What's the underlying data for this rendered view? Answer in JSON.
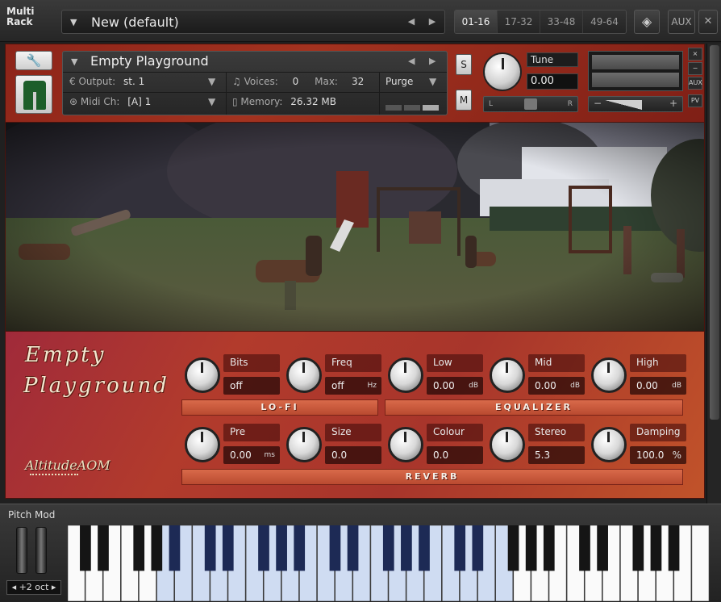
{
  "rack": {
    "title_line1": "Multi",
    "title_line2": "Rack",
    "preset_name": "New (default)",
    "pages": [
      "01-16",
      "17-32",
      "33-48",
      "49-64"
    ],
    "active_page": 0,
    "aux_label": "AUX"
  },
  "instrument": {
    "name": "Empty Playground",
    "output_label": "Output:",
    "output_value": "st. 1",
    "midi_label": "Midi Ch:",
    "midi_value": "[A] 1",
    "voices_label": "Voices:",
    "voices_value": "0",
    "max_label": "Max:",
    "max_value": "32",
    "memory_label": "Memory:",
    "memory_value": "26.32 MB",
    "purge_label": "Purge",
    "solo_label": "S",
    "mute_label": "M",
    "tune_label": "Tune",
    "tune_value": "0.00",
    "pan_left": "L",
    "pan_right": "R",
    "vol_minus": "−",
    "vol_plus": "+",
    "side_close": "×",
    "side_min": "−",
    "side_aux": "AUX",
    "side_pv": "PV"
  },
  "panel": {
    "logo_line1": "Empty",
    "logo_line2": "Playground",
    "brand": "AltitudeAOM",
    "lofi": {
      "section_label": "LO-FI",
      "controls": [
        {
          "label": "Bits",
          "value": "off",
          "unit": ""
        },
        {
          "label": "Freq",
          "value": "off",
          "unit": "Hz"
        }
      ]
    },
    "equalizer": {
      "section_label": "EQUALIZER",
      "controls": [
        {
          "label": "Low",
          "value": "0.00",
          "unit": "dB"
        },
        {
          "label": "Mid",
          "value": "0.00",
          "unit": "dB"
        },
        {
          "label": "High",
          "value": "0.00",
          "unit": "dB"
        }
      ]
    },
    "reverb": {
      "section_label": "REVERB",
      "controls": [
        {
          "label": "Pre",
          "value": "0.00",
          "unit": "ms"
        },
        {
          "label": "Size",
          "value": "0.0",
          "unit": ""
        },
        {
          "label": "Colour",
          "value": "0.0",
          "unit": ""
        },
        {
          "label": "Stereo",
          "value": "5.3",
          "unit": ""
        },
        {
          "label": "Damping",
          "value": "100.0",
          "unit": "%"
        }
      ]
    }
  },
  "keyboard": {
    "pitch_label": "Pitch Mod",
    "octave_label": "+2 oct"
  },
  "colors": {
    "panel_red": "#a8352b",
    "key_highlight": "#cfdcf2",
    "black_key_highlight": "#1d2a55"
  }
}
